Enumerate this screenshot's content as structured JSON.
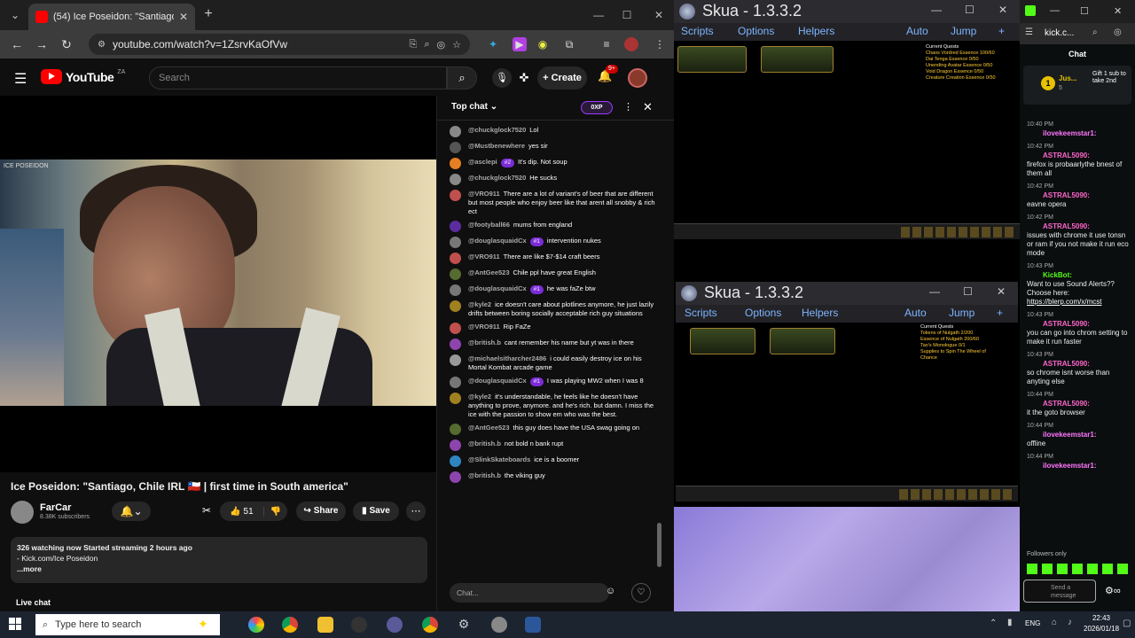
{
  "chrome": {
    "tab_title": "(54) Ice Poseidon: \"Santiago",
    "url": "youtube.com/watch?v=1ZsrvKaOfVw"
  },
  "youtube": {
    "logo": "YouTube",
    "logo_country": "ZA",
    "search_placeholder": "Search",
    "create_label": "Create",
    "notif_count": "9+",
    "video_title": "Ice Poseidon: \"Santiago, Chile IRL 🇨🇱 | first time in South america\"",
    "video_tag": "ICE POSEIDON",
    "channel_name": "FarCar",
    "subscribers": "8.38K subscribers",
    "likes": "51",
    "share_label": "Share",
    "save_label": "Save",
    "desc_stats": "326 watching now  Started streaming 2 hours ago",
    "desc_line": "- Kick.com/Ice Poseidon",
    "desc_more": "...more",
    "live_chat_label": "Live chat"
  },
  "live_chat": {
    "header": "Top chat",
    "xp_pill": "0XP",
    "input_placeholder": "Chat...",
    "messages": [
      {
        "author": "@chuckglock7520",
        "badge": "",
        "text": "Lol",
        "color": "#888888"
      },
      {
        "author": "@Mustbenewhere",
        "badge": "",
        "text": "yes sir",
        "color": "#555555"
      },
      {
        "author": "@asclepi",
        "badge": "#2",
        "text": "It's dip. Not soup",
        "color": "#e67e22"
      },
      {
        "author": "@chuckglock7520",
        "badge": "",
        "text": "He sucks",
        "color": "#888888"
      },
      {
        "author": "@VRO911",
        "badge": "",
        "text": "There are a lot of variant's of beer that are different but most people who enjoy beer like that arent all snobby & rich ect",
        "color": "#c0504d"
      },
      {
        "author": "@footyball66",
        "badge": "",
        "text": "mums from england",
        "color": "#5b2c9f"
      },
      {
        "author": "@douglasquaidCx",
        "badge": "#1",
        "text": "intervention nukes",
        "color": "#777777"
      },
      {
        "author": "@VRO911",
        "badge": "",
        "text": "There are like $7-$14 craft beers",
        "color": "#c0504d"
      },
      {
        "author": "@AntGee523",
        "badge": "",
        "text": "Chile ppl have great English",
        "color": "#556b2f"
      },
      {
        "author": "@douglasquaidCx",
        "badge": "#1",
        "text": "he was faZe btw",
        "color": "#777777"
      },
      {
        "author": "@kyle2",
        "badge": "",
        "text": "ice doesn't care about plotlines anymore, he just lazily drifts between boring socially acceptable rich guy situations",
        "color": "#a08020"
      },
      {
        "author": "@VRO911",
        "badge": "",
        "text": "Rip FaZe",
        "color": "#c0504d"
      },
      {
        "author": "@british.b",
        "badge": "",
        "text": "cant remember his name but yt was in there",
        "color": "#8e44ad"
      },
      {
        "author": "@michaelsitharcher2486",
        "badge": "",
        "text": "i could easily destroy ice on his Mortal Kombat arcade game",
        "color": "#999999"
      },
      {
        "author": "@douglasquaidCx",
        "badge": "#1",
        "text": "I was playing MW2 when I was 8",
        "color": "#777777"
      },
      {
        "author": "@kyle2",
        "badge": "",
        "text": "it's understandable, he feels like he doesn't have anything to prove, anymore. and he's rich. but damn. I miss the ice with the passion to show em who was the best.",
        "color": "#a08020"
      },
      {
        "author": "@AntGee523",
        "badge": "",
        "text": "this guy does have the USA swag going on",
        "color": "#556b2f"
      },
      {
        "author": "@british.b",
        "badge": "",
        "text": "not bold n bank rupt",
        "color": "#8e44ad"
      },
      {
        "author": "@SlinkSkateboards",
        "badge": "",
        "text": "ice is a boomer",
        "color": "#2e86c1"
      },
      {
        "author": "@british.b",
        "badge": "",
        "text": "the viking guy",
        "color": "#8e44ad"
      }
    ]
  },
  "skua": {
    "title": "Skua - 1.3.3.2",
    "menu": [
      "Scripts",
      "Options",
      "Helpers"
    ],
    "auto": "Auto",
    "jump": "Jump",
    "quests_top_title": "Current Quests",
    "quests_top": [
      "Chaos Vordred Essence 100/60",
      "Dai Tenga Essence 0/50",
      "Unending Avatar Essence 0/50",
      "Void Dragon Essence 0/50",
      "Creature Creation Essence 0/50"
    ],
    "quests_bottom_title": "Current Quests",
    "quests_bottom": [
      "Tokens of Nulgath 2/200",
      "Essence of Nulgath 200/60",
      "Tao's Monologue 0/1",
      "Supplies to Spin The Wheel of Chance"
    ]
  },
  "kick": {
    "title": "kick.c...",
    "chat_label": "Chat",
    "pinned_user": "Jus...",
    "pinned_count": "5",
    "pinned_text": "Gift 1 sub to take 2nd",
    "messages": [
      {
        "time": "10:40 PM",
        "user": "ilovekeemstar1:",
        "text": "",
        "color": "#ff77ff"
      },
      {
        "time": "10:42 PM",
        "user": "ASTRAL5090:",
        "text": "firefox is probaarlythe bnest of them all",
        "color": "#ff66cc"
      },
      {
        "time": "10:42 PM",
        "user": "ASTRAL5090:",
        "text": "eavne opera",
        "color": "#ff66cc"
      },
      {
        "time": "10:42 PM",
        "user": "ASTRAL5090:",
        "text": "issues with chrome it use tonsn or ram if you not make it run eco mode",
        "color": "#ff66cc"
      },
      {
        "time": "10:43 PM",
        "user": "KickBot:",
        "text": "Want to use Sound Alerts?? Choose here:",
        "color": "#53fc18",
        "link": "https://blerp.com/x/mcst"
      },
      {
        "time": "10:43 PM",
        "user": "ASTRAL5090:",
        "text": "you can go into chrom setting to make it run faster",
        "color": "#ff66cc"
      },
      {
        "time": "10:43 PM",
        "user": "ASTRAL5090:",
        "text": "so chrome isnt worse than anyting else",
        "color": "#ff66cc"
      },
      {
        "time": "10:44 PM",
        "user": "ASTRAL5090:",
        "text": "it the goto browser",
        "color": "#ff66cc"
      },
      {
        "time": "10:44 PM",
        "user": "ilovekeemstar1:",
        "text": "offline",
        "color": "#ff77ff"
      },
      {
        "time": "10:44 PM",
        "user": "ilovekeemstar1:",
        "text": "",
        "color": "#ff77ff"
      }
    ],
    "followers_only": "Followers only",
    "input_placeholder": "Send a message"
  },
  "taskbar": {
    "search_placeholder": "Type here to search",
    "lang": "ENG",
    "time": "22:43",
    "date": "2026/01/18"
  }
}
